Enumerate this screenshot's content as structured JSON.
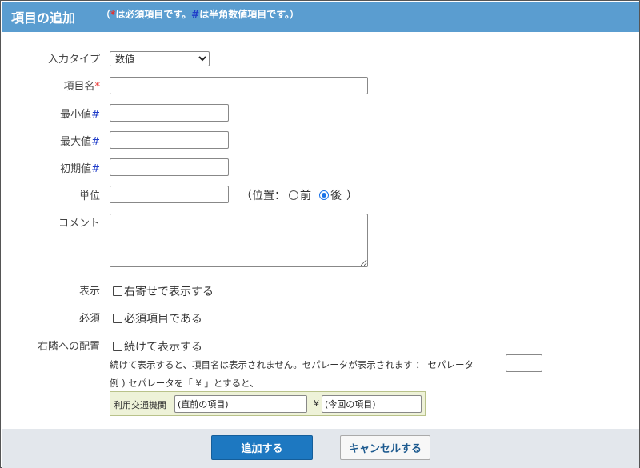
{
  "header": {
    "title": "項目の追加",
    "note_open": "（",
    "note_asterisk": "*",
    "note_part1": "は必須項目です。",
    "note_hash": "#",
    "note_part2": "は半角数値項目です。）"
  },
  "form": {
    "input_type_label": "入力タイプ",
    "input_type_value": "数値",
    "item_name_label": "項目名",
    "required_mark": "*",
    "min_label": "最小値",
    "max_label": "最大値",
    "initial_label": "初期値",
    "numeric_mark": "#",
    "unit_label": "単位",
    "position_prefix": "（位置：",
    "position_before": "前",
    "position_after": "後",
    "position_suffix": "）",
    "position_selected": "後",
    "comment_label": "コメント",
    "display_label": "表示",
    "display_option": "右寄せで表示する",
    "required_label": "必須",
    "required_option": "必須項目である",
    "placement_label": "右隣への配置",
    "placement_option": "続けて表示する",
    "placement_note": "続けて表示すると、項目名は表示されません。セパレータが表示されます ： セパレータ",
    "example_text": "例 ) セパレータを「 ¥ 」とすると、",
    "example_label": "利用交通機関",
    "example_prev_value": "(直前の項目)",
    "example_separator": "¥",
    "example_next_value": "(今回の項目)"
  },
  "footer": {
    "add_label": "追加する",
    "cancel_label": "キャンセルする"
  },
  "colors": {
    "header_bg": "#5a9dd0",
    "primary_button": "#1d78c1",
    "required_red": "#e8312e",
    "numeric_blue": "#1f3cc9"
  }
}
